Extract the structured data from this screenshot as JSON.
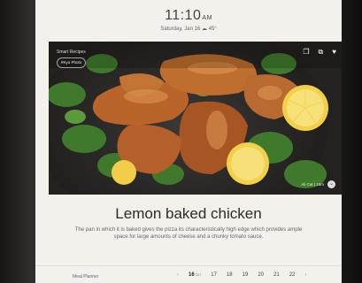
{
  "status": {
    "time": "11:10",
    "ampm": "AM",
    "date_line": "Saturday, Jan 16  ☁ 45°"
  },
  "hero": {
    "top_label": "Smart Recipes",
    "tag": "#Kyo Photo",
    "icons": [
      "bookmark-icon",
      "cast-icon",
      "heart-icon"
    ],
    "caption": "Ali Cat | 15m",
    "chevron": "⌄"
  },
  "recipe": {
    "title": "Lemon baked chicken",
    "description": "The pan in which it is baked gives the pizza its characteristically high edge which provides ample space for large amounts of cheese and a chunky tomato sauce."
  },
  "planner": {
    "label": "Meal Planner",
    "prev": "‹",
    "next": "›",
    "today_suffix": "SAT",
    "days": [
      "16",
      "17",
      "18",
      "19",
      "20",
      "21",
      "22"
    ]
  },
  "colors": {
    "bezel": "#1c1b1a",
    "screen": "#f4f1ec",
    "title_text": "#2c2b29",
    "lemon": "#f2d04a",
    "parsley": "#3f7a2c",
    "chicken": "#b8642a"
  }
}
